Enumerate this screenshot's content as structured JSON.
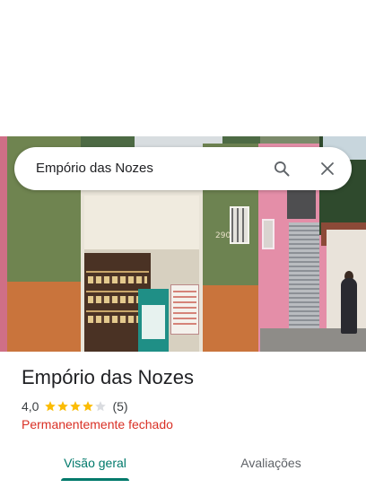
{
  "search": {
    "query": "Empório das Nozes"
  },
  "photo": {
    "building_number": "290"
  },
  "place": {
    "name": "Empório das Nozes",
    "rating": "4,0",
    "rating_value": 4.0,
    "stars_max": 5,
    "review_count": "(5)",
    "status": "Permanentemente fechado"
  },
  "tabs": [
    {
      "label": "Visão geral",
      "selected": true
    },
    {
      "label": "Avaliações",
      "selected": false
    }
  ],
  "colors": {
    "accent": "#00796b",
    "status_closed": "#d93025",
    "star_filled": "#fbbc04",
    "star_empty": "#dadce0"
  },
  "icons": {
    "search": "search-icon",
    "close": "close-icon",
    "star": "star-icon"
  }
}
